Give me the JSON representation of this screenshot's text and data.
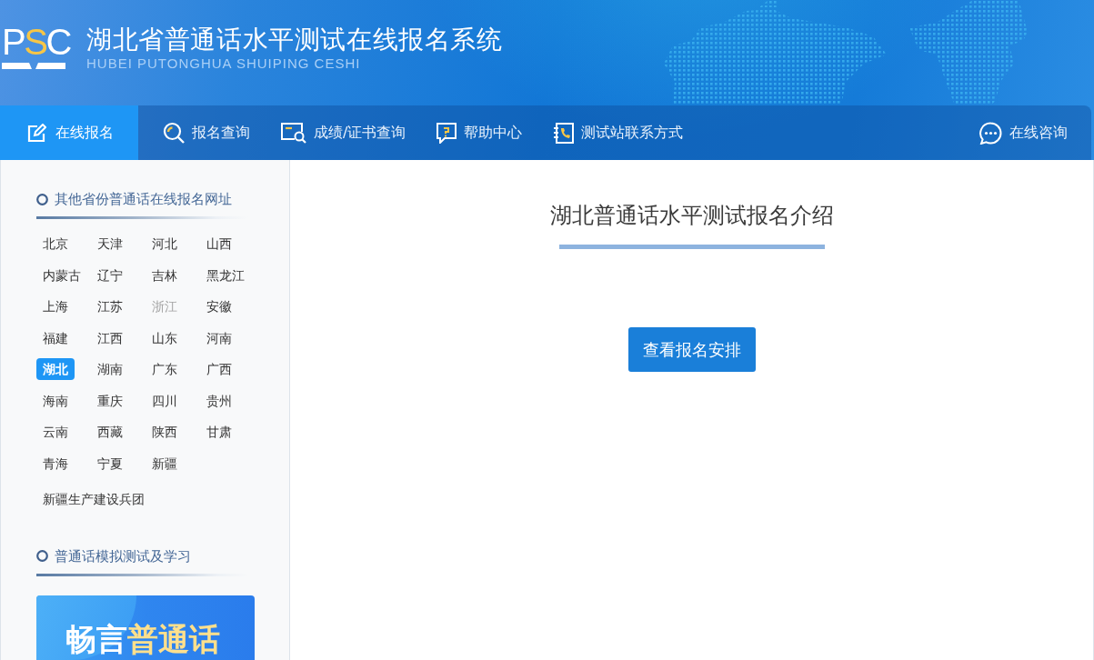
{
  "header": {
    "logo": {
      "parts": [
        {
          "text": "P",
          "accent": false
        },
        {
          "text": "S",
          "accent": true
        },
        {
          "text": "C",
          "accent": false
        }
      ]
    },
    "title": "湖北省普通话水平测试在线报名系统",
    "subtitle": "HUBEI PUTONGHUA SHUIPING CESHI"
  },
  "nav": {
    "items": [
      {
        "label": "在线报名",
        "selected": true
      },
      {
        "label": "报名查询",
        "selected": false
      },
      {
        "label": "成绩/证书查询",
        "selected": false
      },
      {
        "label": "帮助中心",
        "selected": false
      },
      {
        "label": "测试站联系方式",
        "selected": false
      }
    ],
    "consult_link": {
      "label": "在线咨询"
    }
  },
  "sidebar": {
    "sections": [
      {
        "kind": "links",
        "heading": "其他省份普通话在线报名网址",
        "provinces": [
          {
            "label": "北京",
            "selected": false,
            "disabled": false
          },
          {
            "label": "天津",
            "selected": false,
            "disabled": false
          },
          {
            "label": "河北",
            "selected": false,
            "disabled": false
          },
          {
            "label": "山西",
            "selected": false,
            "disabled": false
          },
          {
            "label": "内蒙古",
            "selected": false,
            "disabled": false
          },
          {
            "label": "辽宁",
            "selected": false,
            "disabled": false
          },
          {
            "label": "吉林",
            "selected": false,
            "disabled": false
          },
          {
            "label": "黑龙江",
            "selected": false,
            "disabled": false
          },
          {
            "label": "上海",
            "selected": false,
            "disabled": false
          },
          {
            "label": "江苏",
            "selected": false,
            "disabled": false
          },
          {
            "label": "浙江",
            "selected": false,
            "disabled": true
          },
          {
            "label": "安徽",
            "selected": false,
            "disabled": false
          },
          {
            "label": "福建",
            "selected": false,
            "disabled": false
          },
          {
            "label": "江西",
            "selected": false,
            "disabled": false
          },
          {
            "label": "山东",
            "selected": false,
            "disabled": false
          },
          {
            "label": "河南",
            "selected": false,
            "disabled": false
          },
          {
            "label": "湖北",
            "selected": true,
            "disabled": false
          },
          {
            "label": "湖南",
            "selected": false,
            "disabled": false
          },
          {
            "label": "广东",
            "selected": false,
            "disabled": false
          },
          {
            "label": "广西",
            "selected": false,
            "disabled": false
          },
          {
            "label": "海南",
            "selected": false,
            "disabled": false
          },
          {
            "label": "重庆",
            "selected": false,
            "disabled": false
          },
          {
            "label": "四川",
            "selected": false,
            "disabled": false
          },
          {
            "label": "贵州",
            "selected": false,
            "disabled": false
          },
          {
            "label": "云南",
            "selected": false,
            "disabled": false
          },
          {
            "label": "西藏",
            "selected": false,
            "disabled": false
          },
          {
            "label": "陕西",
            "selected": false,
            "disabled": false
          },
          {
            "label": "甘肃",
            "selected": false,
            "disabled": false
          },
          {
            "label": "青海",
            "selected": false,
            "disabled": false
          },
          {
            "label": "宁夏",
            "selected": false,
            "disabled": false
          },
          {
            "label": "新疆",
            "selected": false,
            "disabled": false
          }
        ],
        "extra_items": [
          {
            "label": "新疆生产建设兵团",
            "selected": false,
            "disabled": false
          }
        ]
      },
      {
        "kind": "banner",
        "heading": "普通话模拟测试及学习",
        "banner": {
          "parts": [
            {
              "text": "畅言",
              "accent": false
            },
            {
              "text": "普通话",
              "accent": true
            }
          ]
        }
      }
    ]
  },
  "main": {
    "title": "湖北普通话水平测试报名介绍",
    "button": "查看报名安排"
  }
}
